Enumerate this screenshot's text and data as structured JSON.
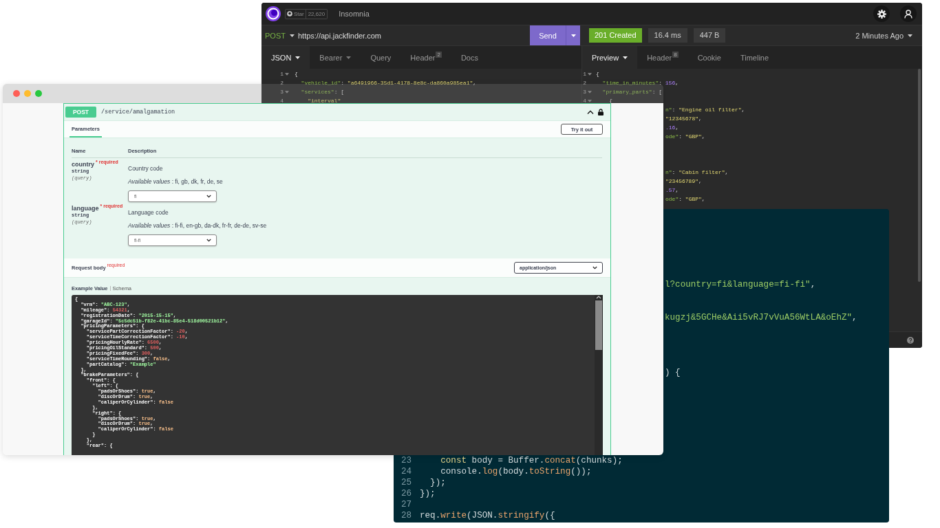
{
  "insomnia": {
    "github": {
      "label": "Star",
      "count": "22,620"
    },
    "title": "Insomnia",
    "request": {
      "method": "POST",
      "url": "https://api.jackfinder.com",
      "send": "Send"
    },
    "response": {
      "status": "201 Created",
      "time": "16.4 ms",
      "size": "447 B",
      "age": "2 Minutes Ago"
    },
    "request_tabs": [
      {
        "label": "JSON",
        "dropdown": true,
        "selected": true
      },
      {
        "label": "Bearer",
        "dropdown": true,
        "selected": false
      },
      {
        "label": "Query",
        "dropdown": false,
        "selected": false
      },
      {
        "label": "Header",
        "count": "2",
        "dropdown": false,
        "selected": false
      },
      {
        "label": "Docs",
        "dropdown": false,
        "selected": false
      }
    ],
    "response_tabs": [
      {
        "label": "Preview",
        "dropdown": true,
        "selected": true
      },
      {
        "label": "Header",
        "count": "8",
        "dropdown": false,
        "selected": false
      },
      {
        "label": "Cookie",
        "dropdown": false,
        "selected": false
      },
      {
        "label": "Timeline",
        "dropdown": false,
        "selected": false
      }
    ],
    "request_lines": [
      {
        "number": "1",
        "text": "{",
        "foldable": true
      },
      {
        "number": "2",
        "text": "  \"vehicle_id\": \"a6491966-35d1-4178-8e8c-da860a985ea1\",",
        "foldable": false
      },
      {
        "number": "3",
        "text": "  \"services\": [",
        "foldable": true
      },
      {
        "number": "4",
        "text": "    \"interval\"",
        "foldable": false
      }
    ],
    "response_lines": [
      {
        "number": "1",
        "text": "{",
        "foldable": true
      },
      {
        "number": "2",
        "text": "  \"time_in_minutes\": 156,",
        "foldable": false
      },
      {
        "number": "3",
        "text": "  \"primary_parts\": [",
        "foldable": true
      },
      {
        "number": "4",
        "text": "    {",
        "foldable": true
      }
    ],
    "response_fragments": [
      "n\": \"Engine oil filter\",",
      "\"12345678\",",
      ".16,",
      "ode\": \"GBP\",",
      "n\": \"Cabin filter\",",
      "\"23456789\",",
      ".57,",
      "ode\": \"GBP\","
    ]
  },
  "code_window": {
    "fragments": [
      [
        {
          "text": "l?country=fi&language=fi-fi\"",
          "kind": "string"
        },
        {
          "text": ",",
          "kind": "plain"
        }
      ],
      [
        {
          "text": "kugzj&5GCHe&Aii5vRJ7vVuA56WtLA&oEhZ\"",
          "kind": "string"
        },
        {
          "text": ",",
          "kind": "plain"
        }
      ],
      [
        {
          "text": ") {",
          "kind": "plain"
        }
      ]
    ],
    "lines": [
      {
        "number": "23",
        "segments": [
          {
            "text": "    const",
            "kind": "keyword"
          },
          {
            "text": " body = Buffer.",
            "kind": "plain"
          },
          {
            "text": "concat",
            "kind": "method"
          },
          {
            "text": "(chunks);",
            "kind": "plain"
          }
        ]
      },
      {
        "number": "24",
        "segments": [
          {
            "text": "    console.",
            "kind": "plain"
          },
          {
            "text": "log",
            "kind": "method"
          },
          {
            "text": "(body.",
            "kind": "plain"
          },
          {
            "text": "toString",
            "kind": "method"
          },
          {
            "text": "());",
            "kind": "plain"
          }
        ]
      },
      {
        "number": "25",
        "segments": [
          {
            "text": "  });",
            "kind": "plain"
          }
        ]
      },
      {
        "number": "26",
        "segments": [
          {
            "text": "});",
            "kind": "plain"
          }
        ]
      },
      {
        "number": "27"
      },
      {
        "number": "28",
        "segments": [
          {
            "text": "req.",
            "kind": "plain"
          },
          {
            "text": "write",
            "kind": "method"
          },
          {
            "text": "(JSON.",
            "kind": "plain"
          },
          {
            "text": "stringify",
            "kind": "method"
          },
          {
            "text": "({",
            "kind": "plain"
          }
        ]
      }
    ]
  },
  "swagger": {
    "operation": {
      "method": "POST",
      "path": "/service/amalgamation",
      "expanded": true
    },
    "tabs": [
      {
        "label": "Parameters",
        "selected": true
      }
    ],
    "try_button": "Try it out",
    "columns": [
      "Name",
      "Description"
    ],
    "parameters": [
      {
        "name": "country",
        "required_note": "* required",
        "type": "string",
        "location": "(query)",
        "description": "Country code",
        "available": "*Available values* : fi, gb, dk, fr, de, se",
        "value": "fi"
      },
      {
        "name": "language",
        "required_note": "* required",
        "type": "string",
        "location": "(query)",
        "description": "Language code",
        "available": "*Available values* : fi-fi, en-gb, da-dk, fr-fr, de-de, sv-se",
        "value": "fi-fi"
      }
    ],
    "request_body": {
      "label": "Request body",
      "note": "required",
      "content_type": "application/json"
    },
    "example_tabs": [
      {
        "label": "Example Value",
        "selected": true
      },
      {
        "label": "Schema",
        "selected": false
      }
    ],
    "example_lines": [
      "{",
      "  \"vrm\": \"ABC-123\",",
      "  \"mileage\": 54321,",
      "  \"registrationDate\": \"2015-15-15\",",
      "  \"garageId\": \"5c5dc51b-f82e-41bc-85e4-518d00521b12\",",
      "  \"pricingParameters\": {",
      "    \"servicePartCorrectionFactor\": -20,",
      "    \"serviceTimeCorrectionFactor\": -10,",
      "    \"pricingHourlyRate\": 6500,",
      "    \"pricingOilStandard\": 500,",
      "    \"pricingFixedFee\": 300,",
      "    \"serviceTimeRounding\": false,",
      "    \"partCatalog\": \"Example\"",
      "  },",
      "  \"brakeParameters\": {",
      "    \"front\": {",
      "      \"left\": {",
      "        \"padsOrShoes\": true,",
      "        \"discOrDrum\": true,",
      "        \"caliperOrCylinder\": false",
      "      },",
      "      \"right\": {",
      "        \"padsOrShoes\": true,",
      "        \"discOrDrum\": true,",
      "        \"caliperOrCylinder\": false",
      "      }",
      "    },",
      "    \"rear\": {"
    ]
  }
}
